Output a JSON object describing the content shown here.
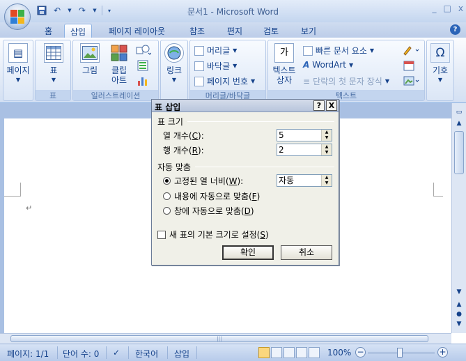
{
  "window": {
    "title": "문서1 - Microsoft Word",
    "controls": [
      "_",
      "□",
      "x"
    ]
  },
  "quick_access": [
    "save-icon",
    "undo-icon",
    "redo-icon"
  ],
  "tabs": [
    {
      "label": "홈"
    },
    {
      "label": "삽입",
      "active": true
    },
    {
      "label": "페이지 레이아웃"
    },
    {
      "label": "참조"
    },
    {
      "label": "편지"
    },
    {
      "label": "검토"
    },
    {
      "label": "보기"
    }
  ],
  "ribbon": {
    "pages": {
      "label": "페이지"
    },
    "table": {
      "button": "표",
      "group": "표"
    },
    "illustrations": {
      "picture": "그림",
      "clipart_1": "클립",
      "clipart_2": "아트",
      "group": "일러스트레이션"
    },
    "links": {
      "button": "링크"
    },
    "header_footer": {
      "header": "머리글",
      "footer": "바닥글",
      "page_number": "페이지 번호",
      "group": "머리글/바닥글"
    },
    "text": {
      "textbox_1": "텍스트",
      "textbox_2": "상자",
      "quick_parts": "빠른 문서 요소",
      "wordart": "WordArt",
      "dropcap": "단락의 첫 문자 장식",
      "group": "텍스트"
    },
    "symbols": {
      "button": "기호"
    }
  },
  "dialog": {
    "title": "표 삽입",
    "help": "?",
    "close": "X",
    "size_section": "표 크기",
    "columns_label_pre": "열 개수(",
    "columns_key": "C",
    "columns_label_post": "):",
    "columns_value": "5",
    "rows_label_pre": "행 개수(",
    "rows_key": "R",
    "rows_label_post": "):",
    "rows_value": "2",
    "autofit_section": "자동 맞춤",
    "fixed_pre": "고정된 열 너비(",
    "fixed_key": "W",
    "fixed_post": "):",
    "fixed_value": "자동",
    "content_pre": "내용에 자동으로 맞춤(",
    "content_key": "F",
    "content_post": ")",
    "window_pre": "창에 자동으로 맞춤(",
    "window_key": "D",
    "window_post": ")",
    "remember_pre": "새 표의 기본 크기로 설정(",
    "remember_key": "S",
    "remember_post": ")",
    "ok": "확인",
    "cancel": "취소"
  },
  "document": {
    "paragraph_mark": "↵"
  },
  "statusbar": {
    "page": "페이지: 1/1",
    "words": "단어 수: 0",
    "language": "한국어",
    "mode": "삽입",
    "zoom": "100%",
    "zoom_value": 1.0
  },
  "colors": {
    "accent": "#15428b",
    "ribbon_bg": "#dbe6f6",
    "frame": "#a9c0e3"
  }
}
